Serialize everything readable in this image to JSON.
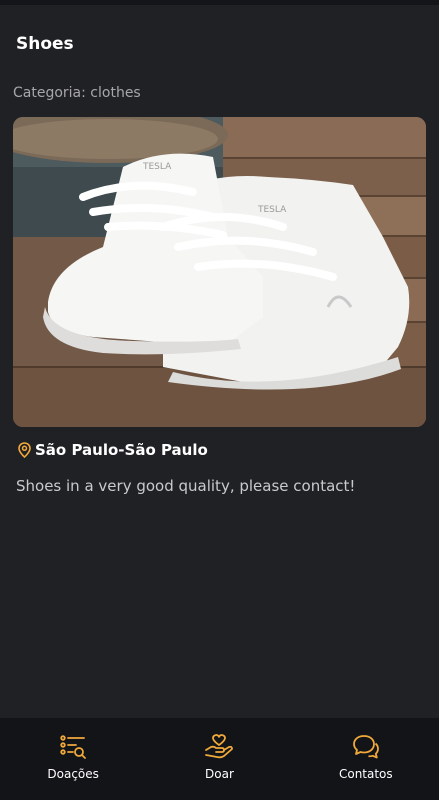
{
  "page": {
    "title": "Shoes",
    "category": "Categoria: clothes",
    "location": "São Paulo-São Paulo",
    "description": "Shoes in a very good quality, please contact!"
  },
  "photo": {
    "subject": "pair of white sneakers on wooden deck"
  },
  "bottom_nav": {
    "items": [
      {
        "label": "Doações",
        "icon": "list-search-icon"
      },
      {
        "label": "Doar",
        "icon": "donate-hand-heart-icon"
      },
      {
        "label": "Contatos",
        "icon": "chat-bubbles-icon"
      }
    ]
  },
  "colors": {
    "background": "#202125",
    "nav_background": "#131418",
    "accent": "#f0a93a",
    "text_primary": "#ffffff",
    "text_secondary": "#a6a7ab"
  }
}
